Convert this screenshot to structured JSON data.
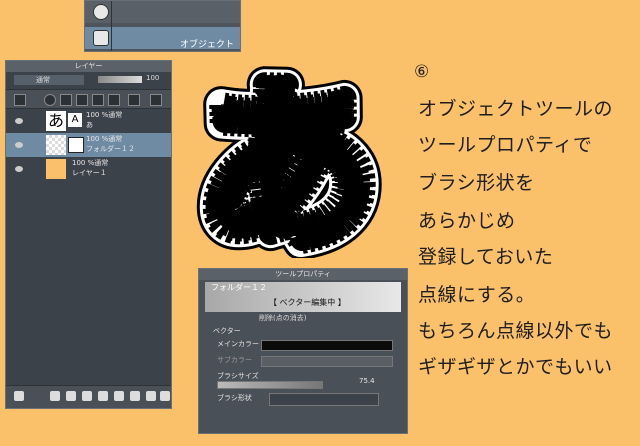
{
  "colors": {
    "background": "#fbc16a",
    "panel": "#3c4249",
    "selection": "#6f8aa3",
    "glyph": "#000000"
  },
  "tool_fragment": {
    "label": "オブジェクト",
    "icon": "object-tool-icon"
  },
  "layer_panel": {
    "title": "レイヤー",
    "blend_mode": "通常",
    "opacity": "100",
    "layers": [
      {
        "mode": "100 %通常",
        "name": "あ",
        "thumb_text": "あ",
        "thumb_badge": "A"
      },
      {
        "mode": "100 %通常",
        "name": "フォルダー１２",
        "selected": true
      },
      {
        "mode": "100 %通常",
        "name": "レイヤー１"
      }
    ]
  },
  "tool_property": {
    "title": "ツールプロパティ",
    "header_title": "フォルダー１２",
    "edit_badge": "【 ベクター編集中 】",
    "subheading": "削除(点の消去)",
    "section": "ベクター",
    "main_color_label": "メインカラー",
    "sub_color_label": "サブカラー",
    "brush_size_label": "ブラシサイズ",
    "brush_size_value": "75.4",
    "brush_shape_label": "ブラシ形状"
  },
  "glyph_char": "あ",
  "instruction": {
    "number": "⑥",
    "lines": [
      "オブジェクトツールの",
      "ツールプロパティで",
      "ブラシ形状を",
      "あらかじめ",
      "登録しておいた",
      "点線にする。",
      "もちろん点線以外でも",
      "ギザギザとかでもいい"
    ]
  }
}
